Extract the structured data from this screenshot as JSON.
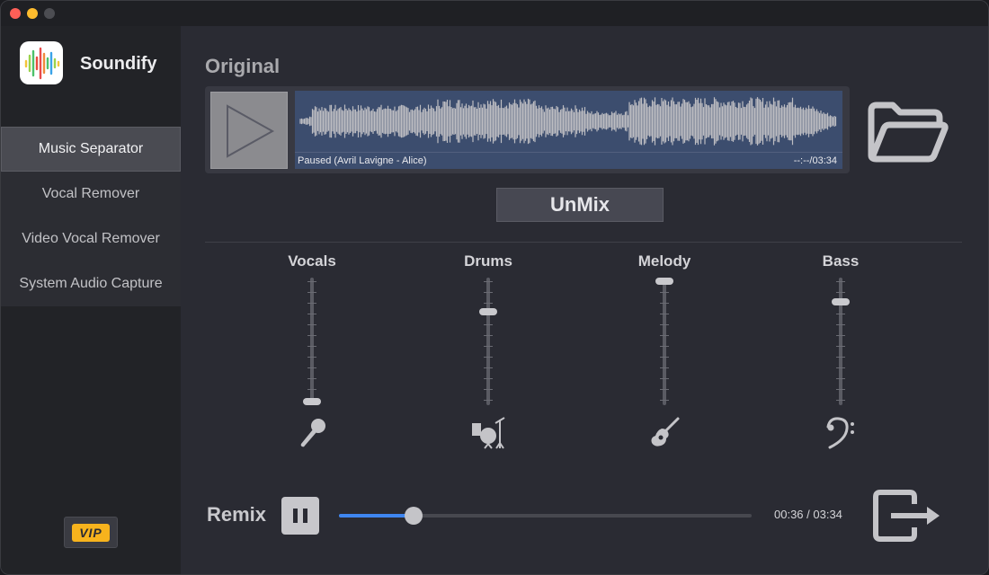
{
  "app": {
    "name": "Soundify",
    "icon": "waveform-app-icon"
  },
  "sidebar": {
    "items": [
      {
        "label": "Music Separator",
        "active": true
      },
      {
        "label": "Vocal Remover",
        "active": false
      },
      {
        "label": "Video Vocal Remover",
        "active": false
      },
      {
        "label": "System Audio Capture",
        "active": false
      }
    ],
    "vip_badge": "VIP"
  },
  "original": {
    "title": "Original",
    "status": "Paused (Avril Lavigne - Alice)",
    "time": "--:--/03:34",
    "play_icon": "play-icon",
    "open_icon": "folder-open-icon"
  },
  "unmix": {
    "label": "UnMix"
  },
  "channels": [
    {
      "label": "Vocals",
      "level": 0.0,
      "icon": "microphone-icon"
    },
    {
      "label": "Drums",
      "level": 0.75,
      "icon": "drum-kit-icon"
    },
    {
      "label": "Melody",
      "level": 1.0,
      "icon": "guitar-icon"
    },
    {
      "label": "Bass",
      "level": 0.83,
      "icon": "bass-clef-icon"
    }
  ],
  "remix": {
    "title": "Remix",
    "time": "00:36 / 03:34",
    "progress": 0.18,
    "pause_icon": "pause-icon",
    "export_icon": "export-icon"
  },
  "colors": {
    "accent": "#3f86f0",
    "vip": "#f7b31d",
    "waveform_bg": "#3c4d6e"
  }
}
